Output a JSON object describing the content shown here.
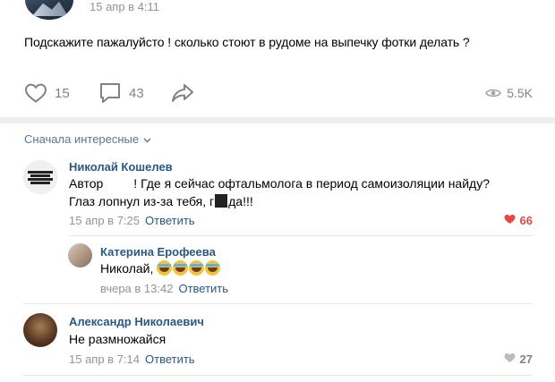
{
  "post": {
    "date": "15 апр в 4:11",
    "text": "Подскажите пажалуйсто ! сколько стоют в рудоме на выпечку фотки делать ?",
    "likes": "15",
    "comments": "43",
    "views": "5.5K"
  },
  "comments_section": {
    "sort_label": "Сначала интересные"
  },
  "comments": [
    {
      "author": "Николай Кошелев",
      "text_line1_a": "Автор",
      "text_line1_b": "! Где я сейчас офтальмолога в период самоизоляции найду?",
      "text_line2_a": "Глаз лопнул из-за тебя, г",
      "text_line2_b": "да!!!",
      "date": "15 апр в 7:25",
      "reply_label": "Ответить",
      "likes": "66",
      "like_color": "#e64646"
    },
    {
      "author": "Катерина Ерофеева",
      "text": "Николай,",
      "date": "вчера в 13:42",
      "reply_label": "Ответить"
    },
    {
      "author": "Александр Николаевич",
      "text": "Не размножайся",
      "date": "15 апр в 7:14",
      "reply_label": "Ответить",
      "likes": "27"
    }
  ],
  "colors": {
    "link": "#2a5885",
    "muted": "#939393",
    "icon": "#828282",
    "like_active": "#e64646"
  }
}
